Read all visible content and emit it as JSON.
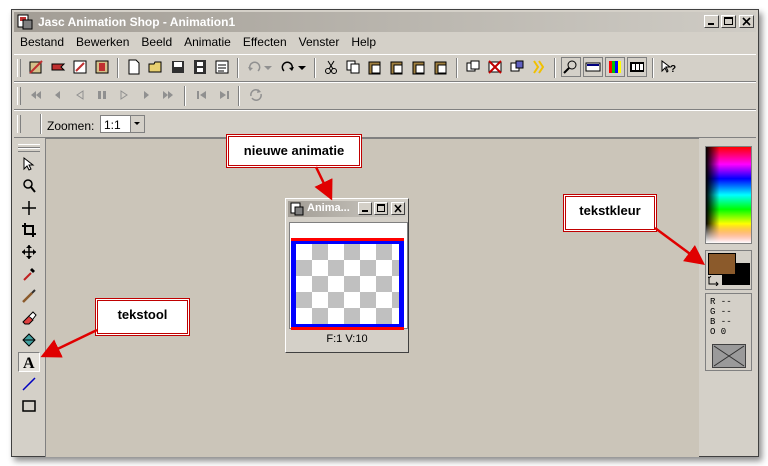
{
  "window": {
    "title": "Jasc Animation Shop - Animation1",
    "min_btn": "_",
    "max_btn": "□",
    "close_btn": "×"
  },
  "menu": [
    "Bestand",
    "Bewerken",
    "Beeld",
    "Animatie",
    "Effecten",
    "Venster",
    "Help"
  ],
  "zoom": {
    "label": "Zoomen:",
    "value": "1:1"
  },
  "color_info": {
    "r": "R --",
    "g": "G --",
    "b": "B --",
    "o": "O 0"
  },
  "colors": {
    "foreground": "#8b5a2b",
    "background": "#000000",
    "workspace": "#cbc5b9",
    "frame_border": "#ff0000",
    "frame_bg": "#0000ff"
  },
  "child_window": {
    "title": "Anima...",
    "status": "F:1   V:10"
  },
  "callouts": {
    "new_animation": "nieuwe animatie",
    "text_color": "tekstkleur",
    "text_tool": "tekstool"
  },
  "tools": [
    "arrow-icon",
    "zoom-icon",
    "mover-icon",
    "crop-icon",
    "move-icon",
    "dropper-icon",
    "brush-icon",
    "eraser-icon",
    "fill-icon",
    "text-icon",
    "line-icon",
    "rectangle-icon"
  ]
}
